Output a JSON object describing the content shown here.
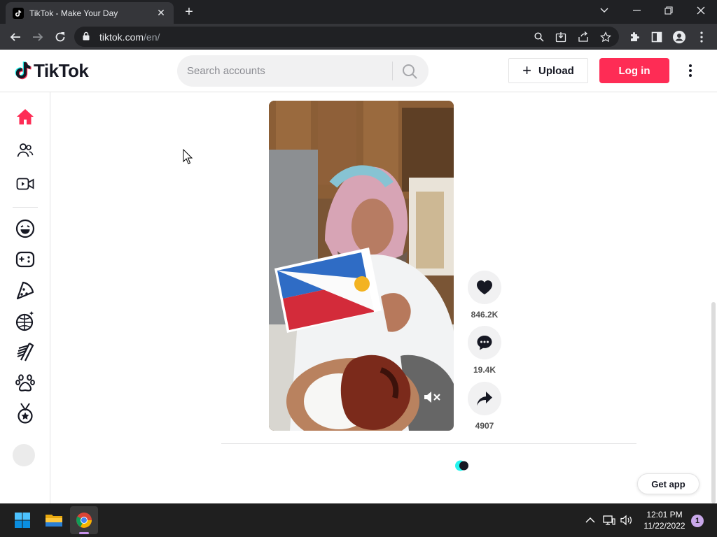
{
  "browser": {
    "tab_title": "TikTok - Make Your Day",
    "url_host": "tiktok.com",
    "url_path": "/en/"
  },
  "header": {
    "logo_text": "TikTok",
    "search_placeholder": "Search accounts",
    "upload_label": "Upload",
    "login_label": "Log in"
  },
  "sidebar": {
    "items": [
      {
        "icon": "home-icon"
      },
      {
        "icon": "following-icon"
      },
      {
        "icon": "live-icon"
      },
      {
        "icon": "comedy-icon"
      },
      {
        "icon": "gaming-icon"
      },
      {
        "icon": "food-icon"
      },
      {
        "icon": "dance-icon"
      },
      {
        "icon": "beauty-icon"
      },
      {
        "icon": "animals-icon"
      },
      {
        "icon": "sports-icon"
      }
    ]
  },
  "video": {
    "likes": "846.2K",
    "comments": "19.4K",
    "shares": "4907"
  },
  "get_app_label": "Get app",
  "taskbar": {
    "time": "12:01 PM",
    "date": "11/22/2022",
    "notification_count": "1"
  },
  "colors": {
    "accent": "#fe2c55",
    "text": "#161823"
  }
}
